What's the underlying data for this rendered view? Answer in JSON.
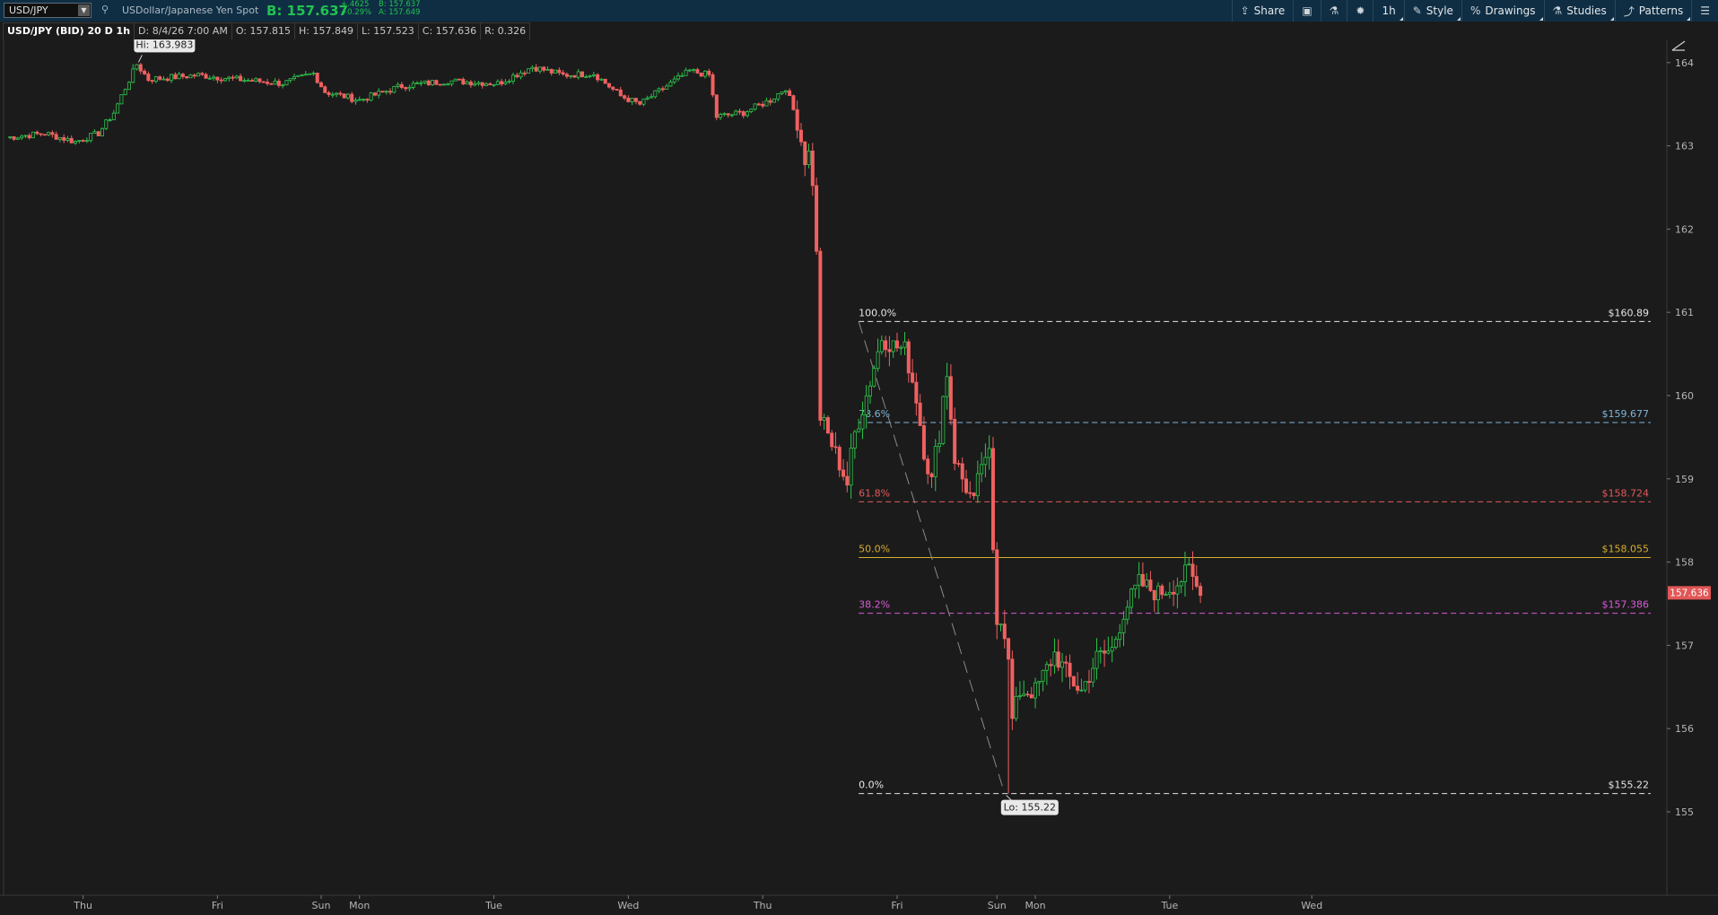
{
  "toolbar": {
    "symbol": "USD/JPY",
    "description": "USDollar/Japanese Yen Spot",
    "bid_display": "B: 157.637",
    "change_abs": "+.4625",
    "change_pct": "+0.29%",
    "bid": "B: 157.637",
    "ask": "A: 157.649",
    "tools": [
      {
        "label": "Share",
        "icon": "share-icon"
      },
      {
        "label": "",
        "icon": "calendar-icon"
      },
      {
        "label": "",
        "icon": "flask-icon"
      },
      {
        "label": "",
        "icon": "gear-icon"
      },
      {
        "label": "1h",
        "icon": ""
      },
      {
        "label": "Style",
        "icon": "style-icon"
      },
      {
        "label": "Drawings",
        "icon": "drawings-icon"
      },
      {
        "label": "Studies",
        "icon": "studies-icon"
      },
      {
        "label": "Patterns",
        "icon": "patterns-icon"
      },
      {
        "label": "",
        "icon": "menu-icon"
      }
    ]
  },
  "infobar": {
    "title": "USD/JPY (BID) 20 D 1h",
    "date": "D: 8/4/26 7:00 AM",
    "open": "O: 157.815",
    "high": "H: 157.849",
    "low": "L: 157.523",
    "close": "C: 157.636",
    "range": "R: 0.326"
  },
  "chart_data": {
    "type": "candlestick",
    "y_ticks": [
      155,
      156,
      157,
      158,
      159,
      160,
      161,
      162,
      163,
      164
    ],
    "ylim": [
      154.65,
      164.95
    ],
    "x_days": [
      "Thu",
      "Fri",
      "Sun",
      "Mon",
      "Tue",
      "Wed",
      "Thu",
      "Fri",
      "Sun",
      "Mon",
      "Tue",
      "Wed"
    ],
    "x_day_index": [
      20,
      55,
      82,
      92,
      127,
      162,
      197,
      232,
      258,
      268,
      303,
      340
    ],
    "index_range": [
      -4,
      370
    ],
    "last_price": "157.636",
    "hi_label": "Hi: 163.983",
    "hi_value": 163.983,
    "hi_index": 33.5,
    "lo_label": "Lo: 155.22",
    "lo_value": 155.22,
    "lo_index": 260,
    "fib_start_index": 222,
    "fib_levels": [
      {
        "pct": "100.0%",
        "price": "$160.89",
        "value": 160.89,
        "color": "#e6e6e6",
        "style": "dashed"
      },
      {
        "pct": "78.6%",
        "price": "$159.677",
        "value": 159.677,
        "color": "#7fb4d8",
        "style": "dashed"
      },
      {
        "pct": "61.8%",
        "price": "$158.724",
        "value": 158.724,
        "color": "#e25a5a",
        "style": "dashed"
      },
      {
        "pct": "50.0%",
        "price": "$158.055",
        "value": 158.055,
        "color": "#d6ad2e",
        "style": "solid"
      },
      {
        "pct": "38.2%",
        "price": "$157.386",
        "value": 157.386,
        "color": "#d75bd8",
        "style": "dashed"
      },
      {
        "pct": "0.0%",
        "price": "$155.22",
        "value": 155.22,
        "color": "#e6e6e6",
        "style": "dashed"
      }
    ],
    "fib_trend": {
      "from_index": 222,
      "from_value": 160.89,
      "to_index": 260,
      "to_value": 155.22
    },
    "colors": {
      "up": "#2ec44c",
      "down": "#f06060",
      "grid": "#2a2a2a",
      "background": "#1b1b1b"
    },
    "anchors": [
      [
        0,
        163.1
      ],
      [
        10,
        163.15
      ],
      [
        18,
        163.05
      ],
      [
        24,
        163.15
      ],
      [
        28,
        163.4
      ],
      [
        30,
        163.6
      ],
      [
        34,
        163.98
      ],
      [
        37,
        163.8
      ],
      [
        50,
        163.85
      ],
      [
        60,
        163.8
      ],
      [
        72,
        163.75
      ],
      [
        80,
        163.87
      ],
      [
        83,
        163.65
      ],
      [
        92,
        163.55
      ],
      [
        103,
        163.72
      ],
      [
        115,
        163.78
      ],
      [
        128,
        163.75
      ],
      [
        137,
        163.95
      ],
      [
        145,
        163.85
      ],
      [
        153,
        163.87
      ],
      [
        160,
        163.6
      ],
      [
        165,
        163.5
      ],
      [
        173,
        163.75
      ],
      [
        178,
        163.9
      ],
      [
        183,
        163.85
      ],
      [
        185,
        163.35
      ],
      [
        192,
        163.4
      ],
      [
        199,
        163.55
      ],
      [
        203,
        163.7
      ],
      [
        206,
        163.3
      ],
      [
        208,
        162.85
      ],
      [
        210,
        162.95
      ],
      [
        212,
        159.75
      ],
      [
        216,
        159.3
      ],
      [
        219,
        158.95
      ],
      [
        221,
        159.55
      ],
      [
        224,
        160.0
      ],
      [
        228,
        160.7
      ],
      [
        231,
        160.6
      ],
      [
        234,
        160.55
      ],
      [
        237,
        160.0
      ],
      [
        239,
        159.35
      ],
      [
        241,
        158.95
      ],
      [
        243,
        159.6
      ],
      [
        245,
        160.35
      ],
      [
        247,
        159.25
      ],
      [
        249,
        159.0
      ],
      [
        252,
        158.7
      ],
      [
        254,
        159.2
      ],
      [
        256,
        159.1
      ],
      [
        258,
        157.35
      ],
      [
        260,
        157.3
      ],
      [
        262,
        156.1
      ],
      [
        264,
        156.45
      ],
      [
        268,
        156.45
      ],
      [
        273,
        156.9
      ],
      [
        277,
        156.6
      ],
      [
        280,
        156.45
      ],
      [
        284,
        156.85
      ],
      [
        288,
        156.95
      ],
      [
        291,
        157.4
      ],
      [
        295,
        157.75
      ],
      [
        300,
        157.62
      ],
      [
        305,
        157.75
      ],
      [
        308,
        157.9
      ],
      [
        311,
        157.6
      ]
    ]
  }
}
